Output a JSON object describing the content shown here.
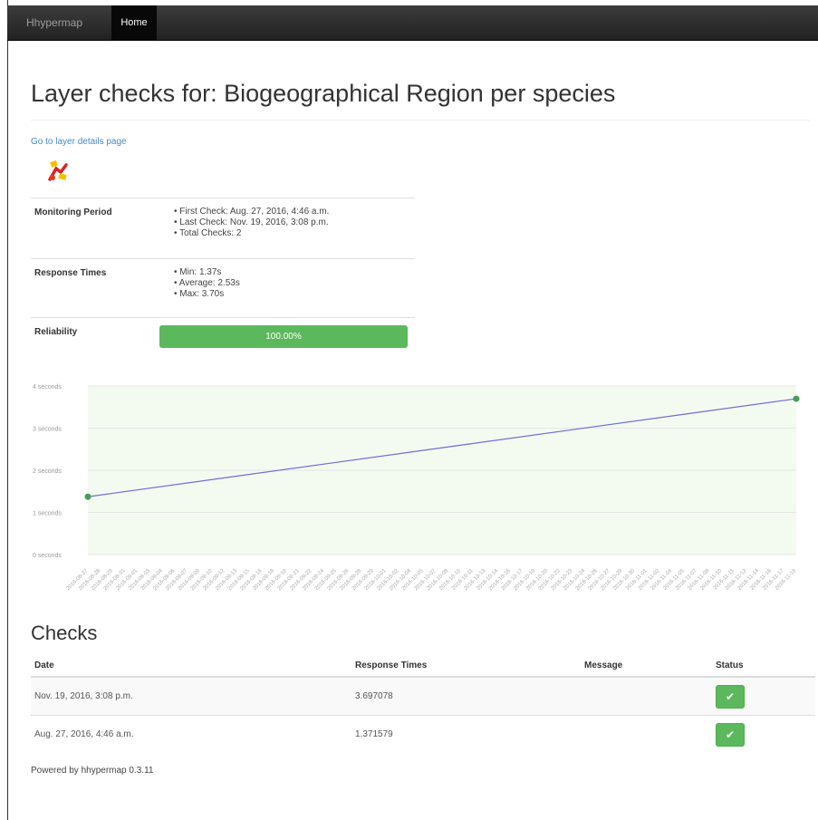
{
  "navbar": {
    "brand": "Hhypermap",
    "home": "Home"
  },
  "page_title": "Layer checks for: Biogeographical Region per species",
  "detail_link": "Go to layer details page",
  "layer_icon": "layer-icon",
  "stats": {
    "monitoring": {
      "label": "Monitoring Period",
      "items": [
        "First Check: Aug. 27, 2016, 4:46 a.m.",
        "Last Check: Nov. 19, 2016, 3:08 p.m.",
        "Total Checks: 2"
      ]
    },
    "response": {
      "label": "Response Times",
      "items": [
        "Min: 1.37s",
        "Average: 2.53s",
        "Max: 3.70s"
      ]
    },
    "reliability": {
      "label": "Reliability",
      "value_text": "100.00%",
      "value": 100
    }
  },
  "chart_data": {
    "type": "line",
    "title": "",
    "ylabel": "",
    "ylim": [
      0,
      4
    ],
    "y_ticks": [
      "4 seconds",
      "3 seconds",
      "2 seconds",
      "1 seconds",
      "0 seconds"
    ],
    "x": [
      "2016-08-27",
      "2016-11-19"
    ],
    "x_tick_count": 58,
    "values": [
      1.371579,
      3.697078
    ],
    "grid": true,
    "line_color": "#6b6bd9",
    "point_color": "#4a9a5a",
    "fill_color": "#f3faf0"
  },
  "checks": {
    "heading": "Checks",
    "columns": [
      "Date",
      "Response Times",
      "Message",
      "Status"
    ],
    "rows": [
      {
        "date": "Nov. 19, 2016, 3:08 p.m.",
        "response": "3.697078",
        "message": "",
        "status_icon": "check-icon"
      },
      {
        "date": "Aug. 27, 2016, 4:46 a.m.",
        "response": "1.371579",
        "message": "",
        "status_icon": "check-icon"
      }
    ]
  },
  "footer": "Powered by hhypermap 0.3.11",
  "colors": {
    "success": "#5cb85c",
    "link": "#428bca",
    "navbar": "#222222"
  }
}
